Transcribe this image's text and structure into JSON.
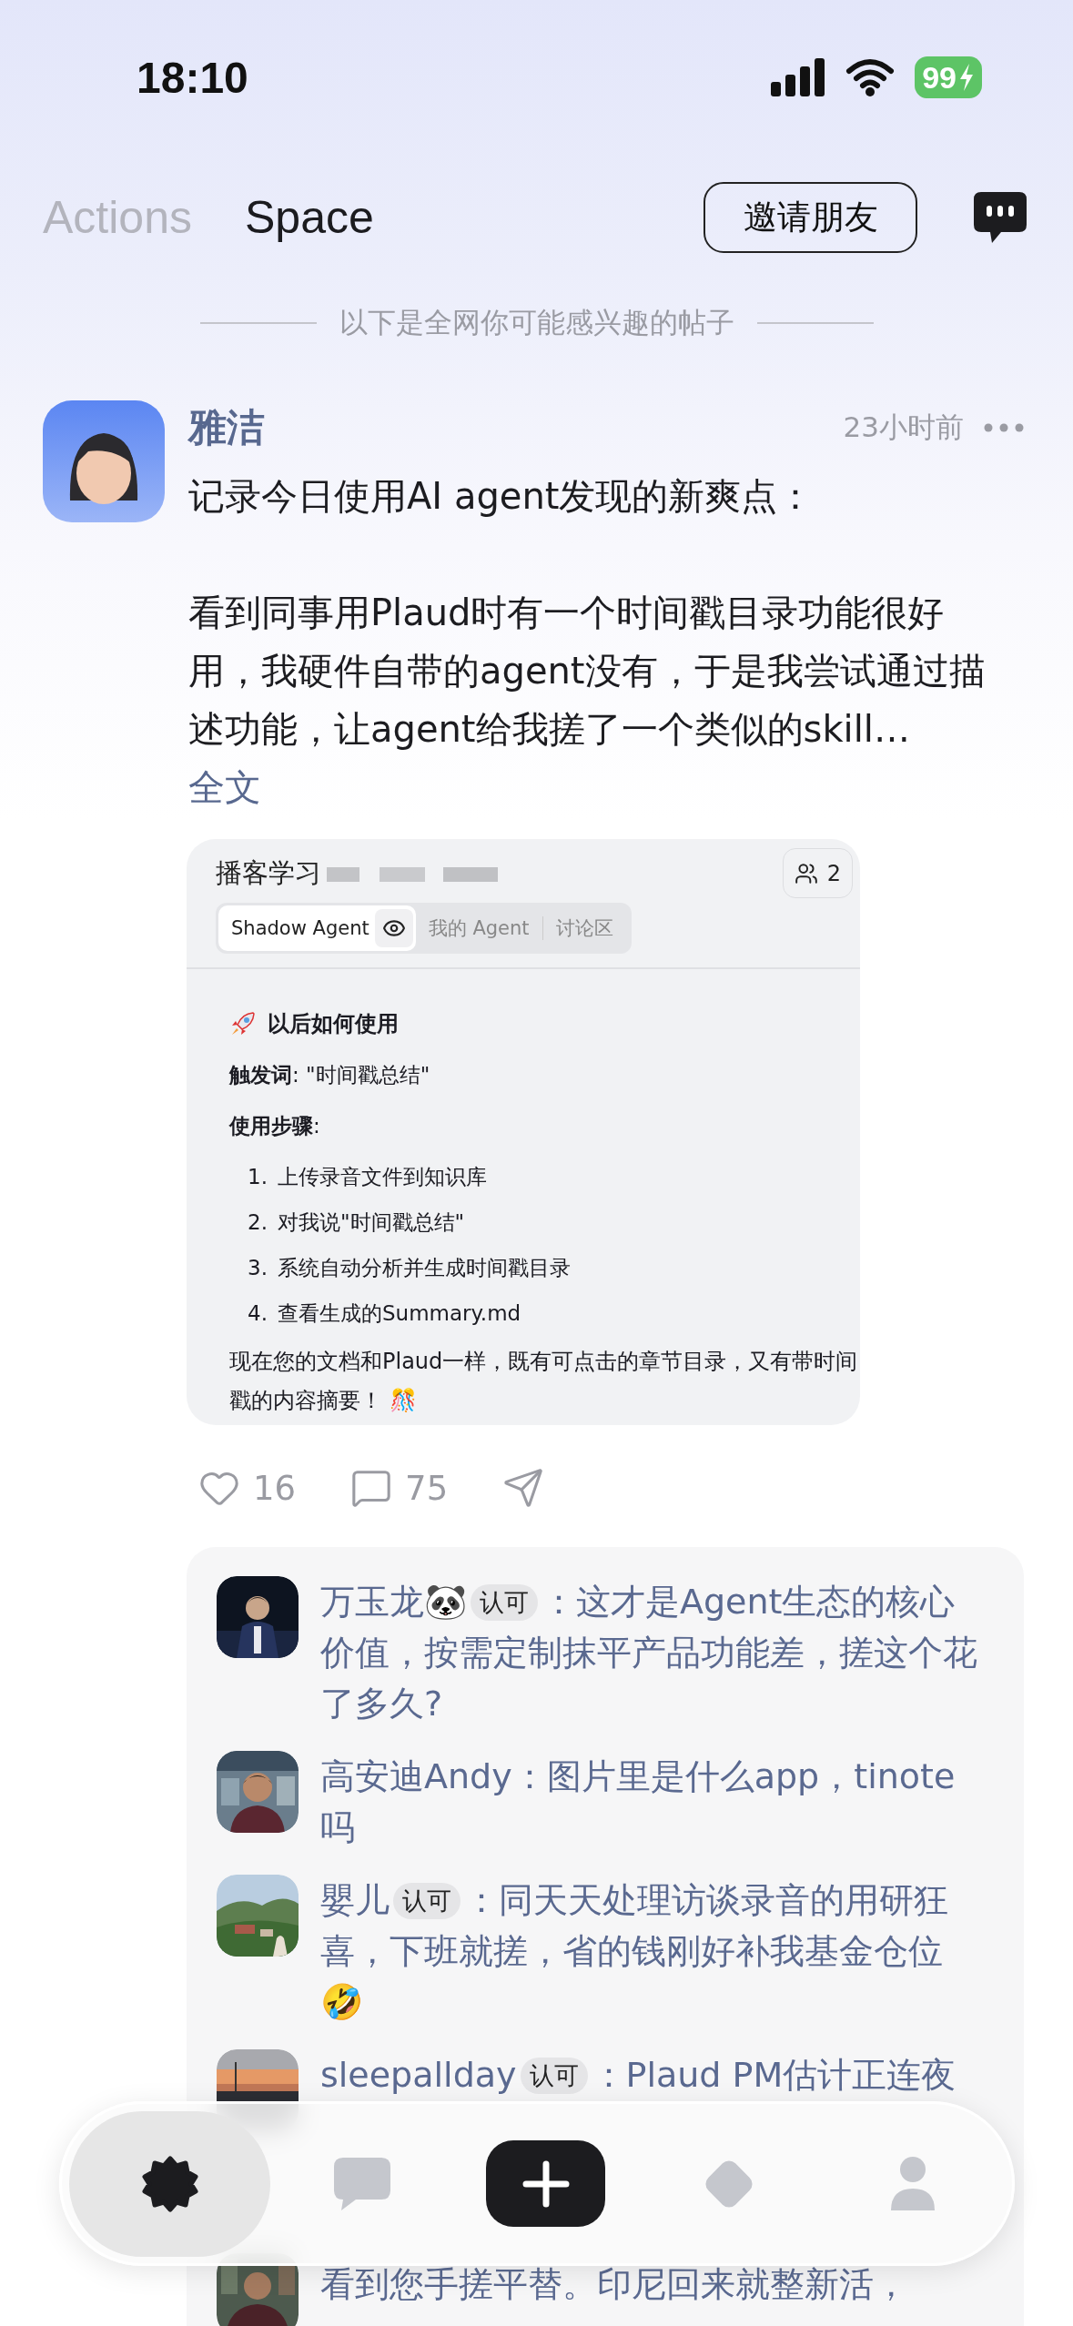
{
  "status_bar": {
    "time": "18:10",
    "battery": "99"
  },
  "header": {
    "tabs": [
      {
        "label": "Actions",
        "selected": false
      },
      {
        "label": "Space",
        "selected": true
      }
    ],
    "invite_button": "邀请朋友"
  },
  "section_divider": "以下是全网你可能感兴趣的帖子",
  "post": {
    "author": "雅洁",
    "time": "23小时前",
    "paragraphs": [
      "记录今日使用AI agent发现的新爽点：",
      "看到同事用Plaud时有一个时间戳目录功能很好用，我硬件自带的agent没有，于是我尝试通过描述功能，让agent给我搓了一个类似的skill…"
    ],
    "expand_link": "全文",
    "attachment": {
      "title": "播客学习",
      "member_count": "2",
      "tabs": [
        {
          "label": "Shadow Agent",
          "selected": true
        },
        {
          "label": "我的 Agent",
          "selected": false
        },
        {
          "label": "讨论区",
          "selected": false
        }
      ],
      "heading": "以后如何使用",
      "lines": [
        "**触发词**: \"时间戳总结\"",
        "**使用步骤**:"
      ],
      "steps": [
        {
          "number": "1.",
          "text": "上传录音文件到知识库"
        },
        {
          "number": "2.",
          "text": "对我说\"时间戳总结\""
        },
        {
          "number": "3.",
          "text": "系统自动分析并生成时间戳目录"
        },
        {
          "number": "4.",
          "text": "查看生成的Summary.md"
        }
      ],
      "closing": "现在您的文档和Plaud一样，既有可点击的章节目录，又有带时间戳的内容摘要！ 🎊"
    },
    "likes": "16",
    "comment_count": "75"
  },
  "comments": [
    {
      "author": "万玉龙🐼",
      "badge": "认可",
      "text": "：这才是Agent生态的核心价值，按需定制抹平产品功能差，搓这个花了多久?"
    },
    {
      "author": "高安迪Andy",
      "text": "：图片里是什么app，tinote吗"
    },
    {
      "author": "嬰儿",
      "badge": "认可",
      "text": "：同天天处理访谈录音的用研狂喜，下班就搓，省的钱刚好补我基金仓位🤣"
    },
    {
      "author": "sleepallday",
      "badge": "认可",
      "text": "：Plaud PM估计正连夜"
    }
  ],
  "partial_comment": {
    "text": "看到您手搓平替。印尼回来就整新活，"
  },
  "tab_bar": {
    "items": [
      {
        "kind": "home",
        "selected": true
      },
      {
        "kind": "messages",
        "selected": false
      },
      {
        "kind": "create",
        "selected": false
      },
      {
        "kind": "discover",
        "selected": false
      },
      {
        "kind": "profile",
        "selected": false
      }
    ]
  }
}
